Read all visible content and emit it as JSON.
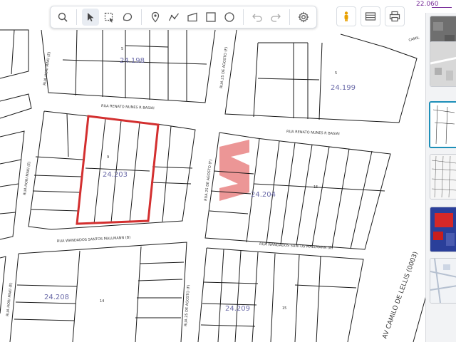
{
  "scale": {
    "label": "22.060"
  },
  "toolbar": {
    "tools": [
      "search",
      "select",
      "box-select",
      "lasso",
      "point",
      "polyline",
      "polygon",
      "rectangle",
      "circle",
      "undo",
      "redo",
      "settings"
    ],
    "active": "select"
  },
  "map": {
    "colors": {
      "lot_outline": "#1a1a1a",
      "selection": "#d32f2f",
      "block_id": "#6a6aa8",
      "watermark": "#e57373"
    },
    "block_ids": [
      "24.198",
      "24.199",
      "24.203",
      "24.204",
      "24.208",
      "24.209"
    ],
    "lot_numbers": [
      "5",
      "5",
      "9",
      "15",
      "14",
      "15"
    ],
    "streets": {
      "renato_north": "RUA RENATO NUNES R BASIAI",
      "renato_east": "RUA RENATO NUNES R BASIAI",
      "wandados_west": "RUA WANDADOS SANTOS MALLMANN (B)",
      "wandados_east": "RUA WANDADOS SANTOS MALLMANN (B)",
      "avenue": "AV CAMILO DE LELLIS (0003)",
      "agosto_north": "RUA 25 DE AGOSTO (F)",
      "agosto_mid": "RUA 25 DE AGOSTO (F)",
      "agosto_south": "RUA 25 DE AGOSTO (F)",
      "hori_upper": "RUA HORI MAKI (E)",
      "hori_mid": "RUA HORI MAKI (E)",
      "hori_lower": "RUA HORI MAKI (E)",
      "corner": "CAMIL"
    },
    "selected_block": "24.203"
  },
  "layers": {
    "thumbnails": [
      "satellite-dark",
      "satellite-light",
      "parcel-map",
      "parcel-map-dense",
      "thematic-red",
      "street-map"
    ],
    "selected": "parcel-map"
  }
}
